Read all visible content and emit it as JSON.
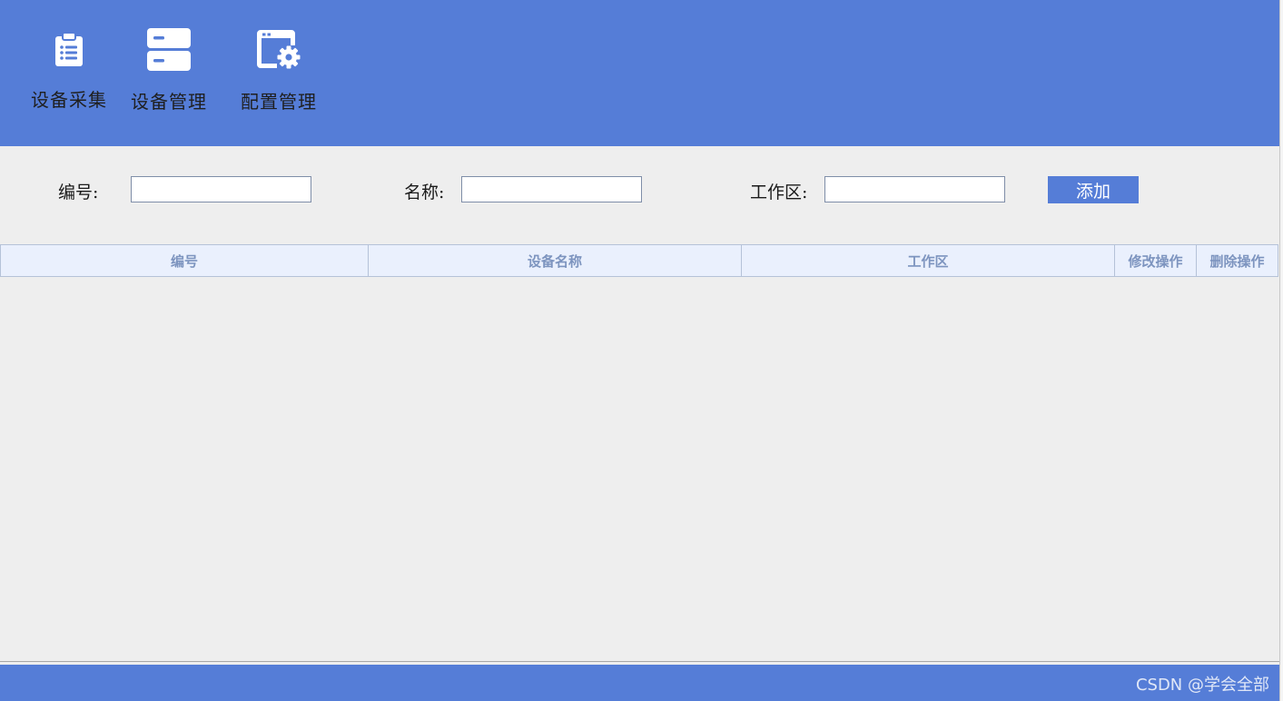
{
  "nav": {
    "items": [
      {
        "label": "设备采集",
        "icon": "clipboard-list-icon"
      },
      {
        "label": "设备管理",
        "icon": "server-stack-icon"
      },
      {
        "label": "配置管理",
        "icon": "window-gear-icon"
      }
    ]
  },
  "form": {
    "number_label": "编号:",
    "name_label": "名称:",
    "workarea_label": "工作区:",
    "number_value": "",
    "name_value": "",
    "workarea_value": "",
    "add_label": "添加"
  },
  "table": {
    "columns": [
      "编号",
      "设备名称",
      "工作区",
      "修改操作",
      "删除操作"
    ],
    "rows": []
  },
  "watermark": "CSDN @学会全部",
  "colors": {
    "accent": "#557dd7",
    "header_cell_bg": "#eaf0fd",
    "header_cell_text": "#7d94bf",
    "panel_bg": "#eeeeee"
  }
}
